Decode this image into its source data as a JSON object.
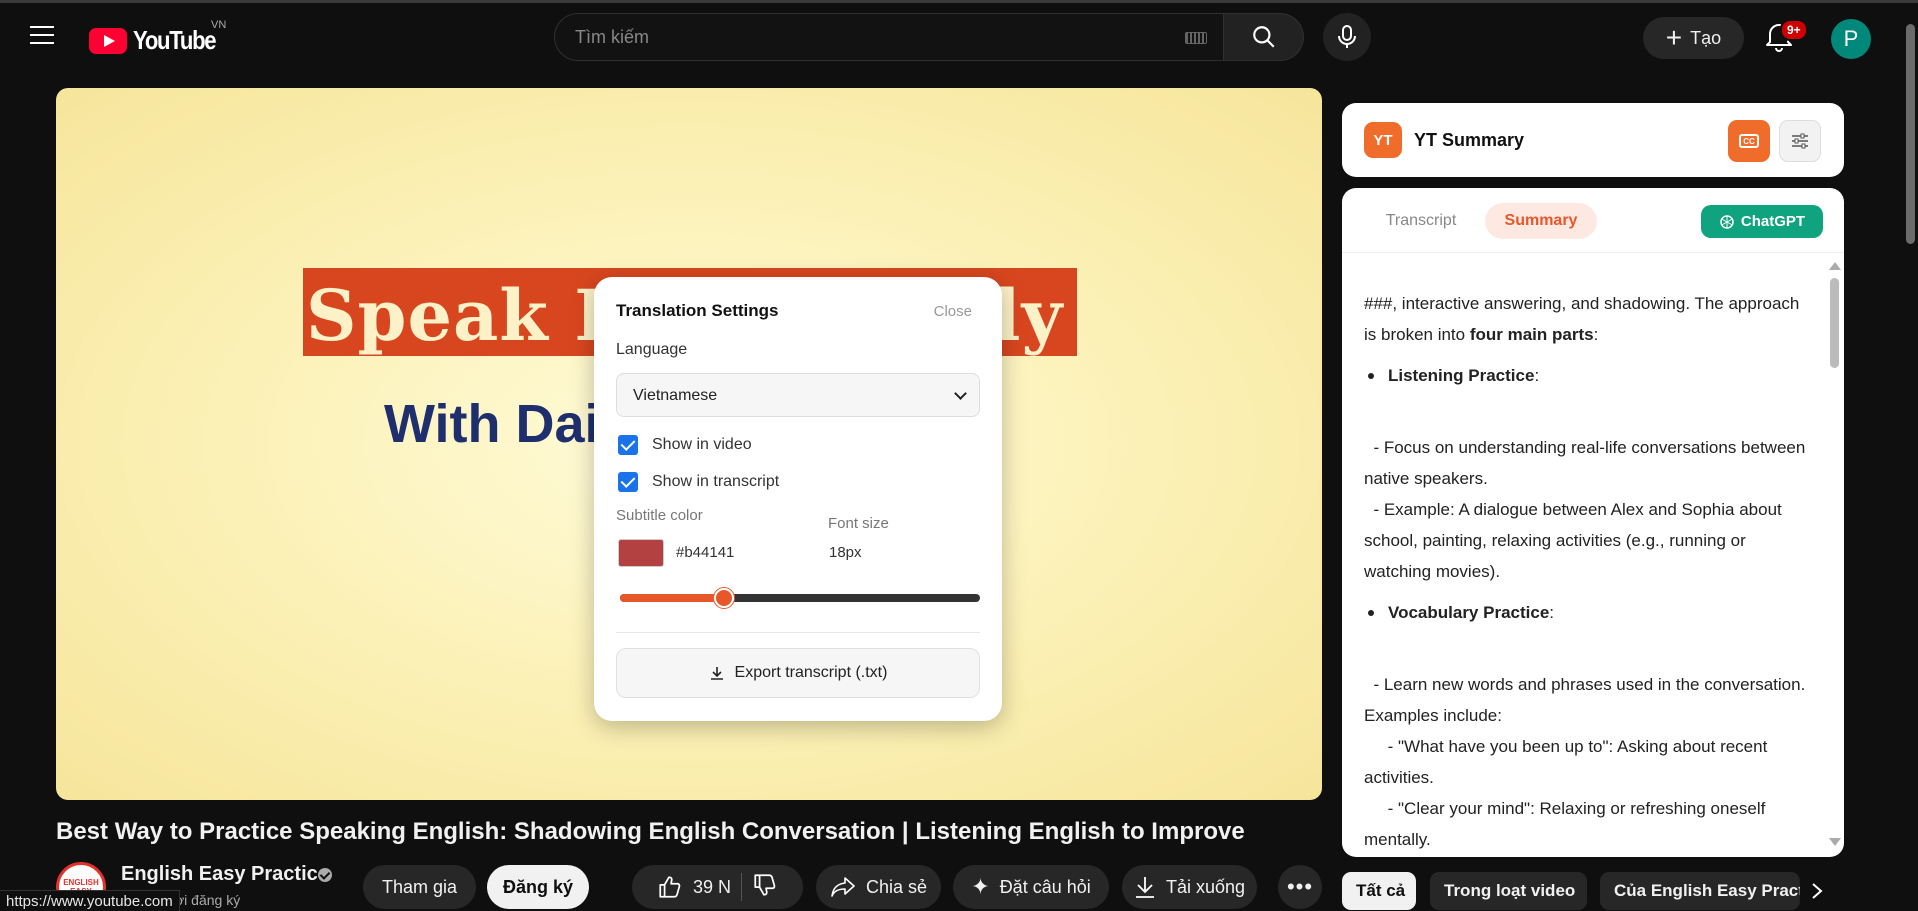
{
  "header": {
    "logo_text": "YouTube",
    "country_code": "VN",
    "search_placeholder": "Tìm kiếm",
    "create_label": "Tạo",
    "notification_badge": "9+",
    "avatar_letter": "P"
  },
  "video": {
    "thumb_line1": "Speak En",
    "thumb_line1_end": "tly",
    "thumb_line2": "With Dai",
    "title": "Best Way to Practice Speaking English: Shadowing English Conversation | Listening English to Improve",
    "channel_name": "English Easy Practice",
    "channel_avatar_text": "ENGLISH EASY",
    "subscribers_partial": "ời đăng ký",
    "join_label": "Tham gia",
    "subscribe_label": "Đăng ký",
    "like_count": "39 N",
    "share_label": "Chia sẻ",
    "ask_label": "Đặt câu hỏi",
    "download_label": "Tải xuống"
  },
  "translation_popup": {
    "title": "Translation Settings",
    "close_label": "Close",
    "language_label": "Language",
    "language_value": "Vietnamese",
    "show_in_video_label": "Show in video",
    "show_in_video_checked": true,
    "show_in_transcript_label": "Show in transcript",
    "show_in_transcript_checked": true,
    "subtitle_color_label": "Subtitle color",
    "subtitle_color_value": "#b44141",
    "font_size_label": "Font size",
    "font_size_value": "18px",
    "font_size_slider_fraction": 0.29,
    "export_label": "Export transcript (.txt)"
  },
  "yt_summary": {
    "logo_text": "YT",
    "title": "YT Summary",
    "tab_transcript": "Transcript",
    "tab_summary": "Summary",
    "chatgpt_label": "ChatGPT",
    "intro_text": "###, interactive answering, and shadowing. The approach is broken into ",
    "intro_bold": "four main parts",
    "intro_colon": ":",
    "part1_title": "Listening Practice",
    "part1_line1": "- Focus on understanding real-life conversations between native speakers.",
    "part1_line2": "- Example: A dialogue between Alex and Sophia about school, painting, relaxing activities (e.g., running or watching movies).",
    "part2_title": "Vocabulary Practice",
    "part2_line1": "- Learn new words and phrases used in the conversation. Examples include:",
    "part2_line2": "- \"What have you been up to\": Asking about recent activities.",
    "part2_line3": "- \"Clear your mind\": Relaxing or refreshing oneself mentally."
  },
  "chips": [
    "Tất cả",
    "Trong loạt video",
    "Của English Easy Practice"
  ],
  "status_url": "https://www.youtube.com",
  "colors": {
    "youtube_red": "#ff0033",
    "accent_orange": "#ef6c2a",
    "chatgpt_green": "#10a37f",
    "checkbox_blue": "#1a73e8",
    "subtitle_swatch": "#b44141"
  }
}
